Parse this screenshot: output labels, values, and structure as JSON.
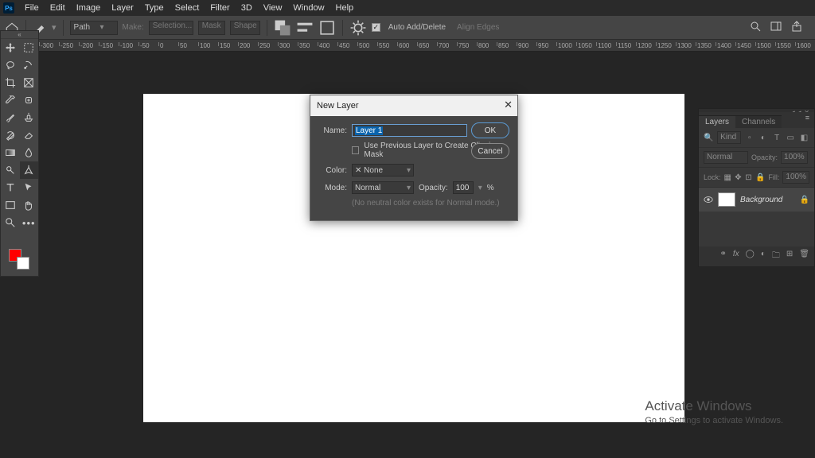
{
  "menu": {
    "items": [
      "File",
      "Edit",
      "Image",
      "Layer",
      "Type",
      "Select",
      "Filter",
      "3D",
      "View",
      "Window",
      "Help"
    ]
  },
  "optionsbar": {
    "path_label": "Path",
    "make": "Make:",
    "selection": "Selection...",
    "mask": "Mask",
    "shape": "Shape",
    "auto_add": "Auto Add/Delete",
    "align_edges": "Align Edges"
  },
  "ruler": {
    "start": -300,
    "step": 50,
    "count": 46
  },
  "dialog": {
    "title": "New Layer",
    "name_label": "Name:",
    "name_value": "Layer 1",
    "clip": "Use Previous Layer to Create Clipping Mask",
    "color_label": "Color:",
    "color_value": "None",
    "mode_label": "Mode:",
    "mode_value": "Normal",
    "opacity_label": "Opacity:",
    "opacity_value": "100",
    "opacity_unit": "%",
    "hint": "(No neutral color exists for Normal mode.)",
    "ok": "OK",
    "cancel": "Cancel"
  },
  "panels": {
    "tabs": [
      "Layers",
      "Channels"
    ],
    "kind_placeholder": "Kind",
    "blend": "Normal",
    "opacity_label": "Opacity:",
    "opacity_value": "100%",
    "lock_label": "Lock:",
    "fill_label": "Fill:",
    "fill_value": "100%",
    "layer_name": "Background"
  },
  "watermark": {
    "title": "Activate Windows",
    "sub": "Go to Settings to activate Windows."
  },
  "colors": {
    "fg": "#ff0000",
    "bg": "#ffffff"
  }
}
